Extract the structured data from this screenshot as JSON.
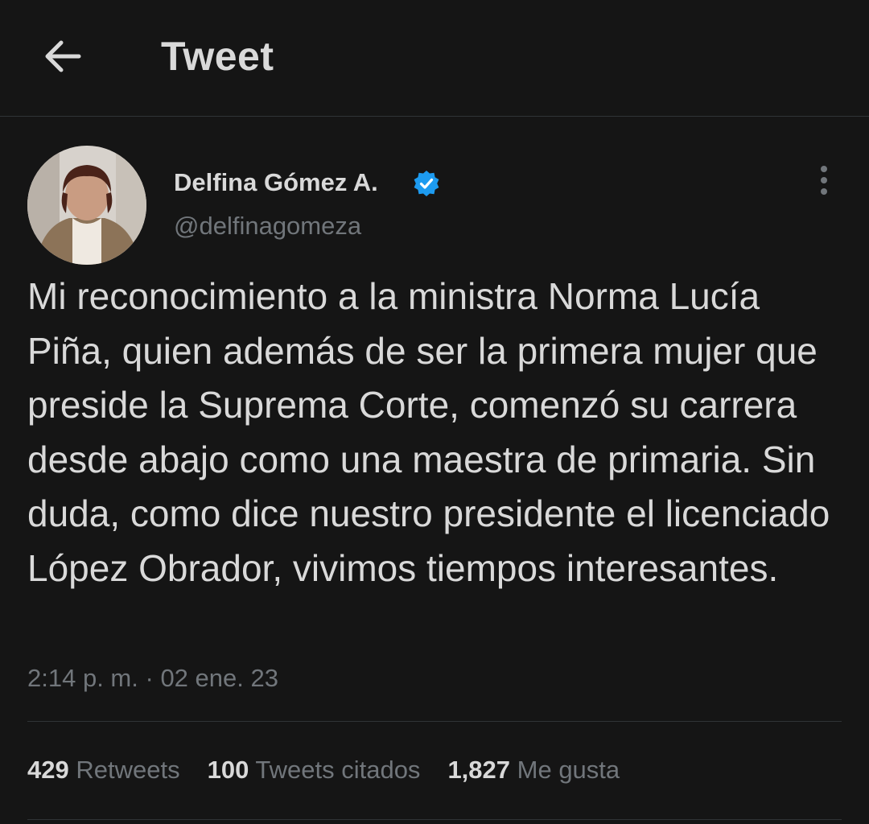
{
  "header": {
    "title": "Tweet",
    "back_icon": "arrow-left-icon"
  },
  "author": {
    "name": "Delfina Gómez A.",
    "handle": "@delfinagomeza",
    "verified": true,
    "verified_color": "#1d9bf0"
  },
  "tweet": {
    "text": "Mi reconocimiento a la ministra Norma Lucía Piña, quien además de ser la primera mujer que preside la Suprema Corte, comenzó su carrera desde abajo como una maestra de primaria. Sin duda, como dice nuestro presidente el licenciado López Obrador, vivimos tiempos interesantes.",
    "time": "2:14 p. m.",
    "separator": "·",
    "date": "02 ene. 23"
  },
  "stats": {
    "retweets_count": "429",
    "retweets_label": "Retweets",
    "quotes_count": "100",
    "quotes_label": "Tweets citados",
    "likes_count": "1,827",
    "likes_label": "Me gusta"
  },
  "colors": {
    "background": "#151515",
    "primary_text": "#d9d9d9",
    "secondary_text": "#71767b",
    "divider": "#2f3336"
  }
}
